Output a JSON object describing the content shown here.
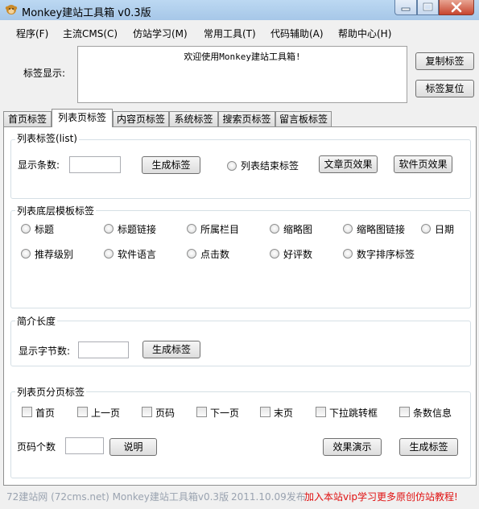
{
  "window": {
    "title": "Monkey建站工具箱 v0.3版"
  },
  "menu": [
    "程序(F)",
    "主流CMS(C)",
    "仿站学习(M)",
    "常用工具(T)",
    "代码辅助(A)",
    "帮助中心(H)"
  ],
  "tag_display": {
    "label": "标签显示:",
    "content": "欢迎使用Monkey建站工具箱!",
    "copy_button": "复制标签",
    "reset_button": "标签复位"
  },
  "tabs": [
    "首页标签",
    "列表页标签",
    "内容页标签",
    "系统标签",
    "搜索页标签",
    "留言板标签"
  ],
  "active_tab": "列表页标签",
  "list_tag": {
    "title": "列表标签(list)",
    "count_label": "显示条数:",
    "count_value": "",
    "generate_button": "生成标签",
    "end_tag_radio": "列表结束标签",
    "article_effect_button": "文章页效果",
    "software_effect_button": "软件页效果"
  },
  "template_tags": {
    "title": "列表底层模板标签",
    "row1": [
      "标题",
      "标题链接",
      "所属栏目",
      "缩略图",
      "缩略图链接",
      "日期"
    ],
    "row2": [
      "推荐级别",
      "软件语言",
      "点击数",
      "好评数",
      "数字排序标签"
    ]
  },
  "intro_length": {
    "title": "简介长度",
    "label": "显示字节数:",
    "value": "",
    "generate_button": "生成标签"
  },
  "pagination": {
    "title": "列表页分页标签",
    "checkboxes": [
      "首页",
      "上一页",
      "页码",
      "下一页",
      "末页",
      "下拉跳转框",
      "条数信息"
    ],
    "page_count_label": "页码个数",
    "page_count_value": "",
    "explain_button": "说明",
    "demo_button": "效果演示",
    "generate_button": "生成标签"
  },
  "status": {
    "left": "72建站网 (72cms.net) Monkey建站工具箱v0.3版",
    "date": "2011.10.09发布",
    "promo": "加入本站vip学习更多原创仿站教程!",
    "colors": {
      "left": "#9aa3b0",
      "promo": "#e01010"
    }
  }
}
